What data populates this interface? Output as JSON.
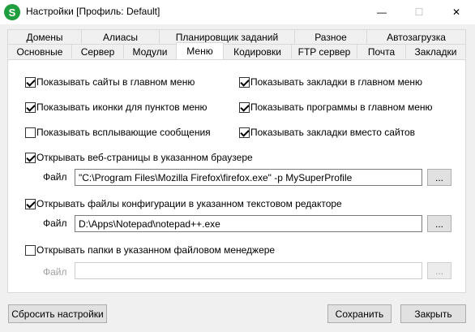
{
  "window": {
    "title": "Настройки [Профиль: Default]",
    "icon_letter": "S",
    "minimize_glyph": "—",
    "maximize_glyph": "☐",
    "close_glyph": "✕"
  },
  "tabs_row1": [
    "Домены",
    "Алиасы",
    "Планировщик заданий",
    "Разное",
    "Автозагрузка"
  ],
  "tabs_row2": [
    "Основные",
    "Сервер",
    "Модули",
    "Меню",
    "Кодировки",
    "FTP сервер",
    "Почта",
    "Закладки"
  ],
  "active_tab": "Меню",
  "options": {
    "show_sites": {
      "label": "Показывать сайты в главном меню",
      "checked": true
    },
    "show_bookmarks": {
      "label": "Показывать закладки в главном меню",
      "checked": true
    },
    "show_icons": {
      "label": "Показывать иконки для пунктов меню",
      "checked": true
    },
    "show_programs": {
      "label": "Показывать программы в главном меню",
      "checked": true
    },
    "show_popups": {
      "label": "Показывать всплывающие сообщения",
      "checked": false
    },
    "bookmarks_instead": {
      "label": "Показывать закладки вместо сайтов",
      "checked": true
    },
    "open_browser": {
      "label": "Открывать веб-страницы в указанном браузере",
      "checked": true
    },
    "open_editor": {
      "label": "Открывать файлы конфигурации в указанном текстовом редакторе",
      "checked": true
    },
    "open_filemanager": {
      "label": "Открывать папки в указанном файловом менеджере",
      "checked": false
    }
  },
  "files": {
    "label": "Файл",
    "browse_label": "...",
    "browser_path": "\"C:\\Program Files\\Mozilla Firefox\\firefox.exe\" -p MySuperProfile",
    "editor_path": "D:\\Apps\\Notepad\\notepad++.exe",
    "filemanager_path": ""
  },
  "buttons": {
    "reset": "Сбросить настройки",
    "save": "Сохранить",
    "close": "Закрыть"
  }
}
